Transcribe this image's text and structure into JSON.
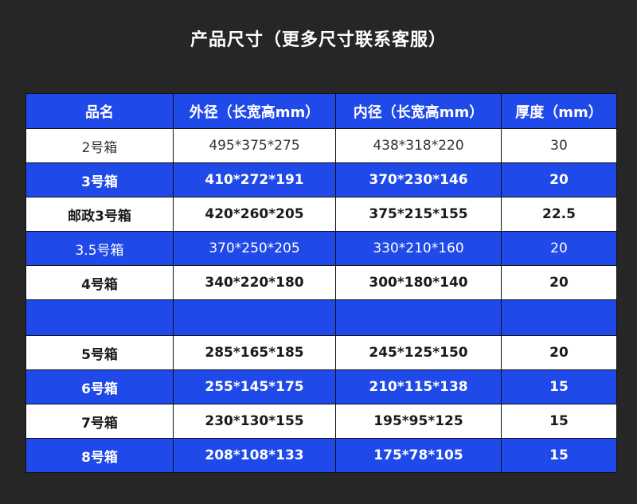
{
  "title": "产品尺寸（更多尺寸联系客服）",
  "table": {
    "headers": [
      "品名",
      "外径（长宽高mm）",
      "内径（长宽高mm）",
      "厚度（mm）"
    ],
    "rows": [
      {
        "name": "2号箱",
        "outer": "495*375*275",
        "inner": "438*318*220",
        "thickness": "30"
      },
      {
        "name": "3号箱",
        "outer": "410*272*191",
        "inner": "370*230*146",
        "thickness": "20"
      },
      {
        "name": "邮政3号箱",
        "outer": "420*260*205",
        "inner": "375*215*155",
        "thickness": "22.5"
      },
      {
        "name": "3.5号箱",
        "outer": "370*250*205",
        "inner": "330*210*160",
        "thickness": "20"
      },
      {
        "name": "4号箱",
        "outer": "340*220*180",
        "inner": "300*180*140",
        "thickness": "20"
      },
      {
        "name": "",
        "outer": "",
        "inner": "",
        "thickness": ""
      },
      {
        "name": "5号箱",
        "outer": "285*165*185",
        "inner": "245*125*150",
        "thickness": "20"
      },
      {
        "name": "6号箱",
        "outer": "255*145*175",
        "inner": "210*115*138",
        "thickness": "15"
      },
      {
        "name": "7号箱",
        "outer": "230*130*155",
        "inner": "195*95*125",
        "thickness": "15"
      },
      {
        "name": "8号箱",
        "outer": "208*108*133",
        "inner": "175*78*105",
        "thickness": "15"
      }
    ]
  },
  "colors": {
    "background": "#262626",
    "header_blue": "#1f49e8",
    "row_white": "#ffffff"
  }
}
